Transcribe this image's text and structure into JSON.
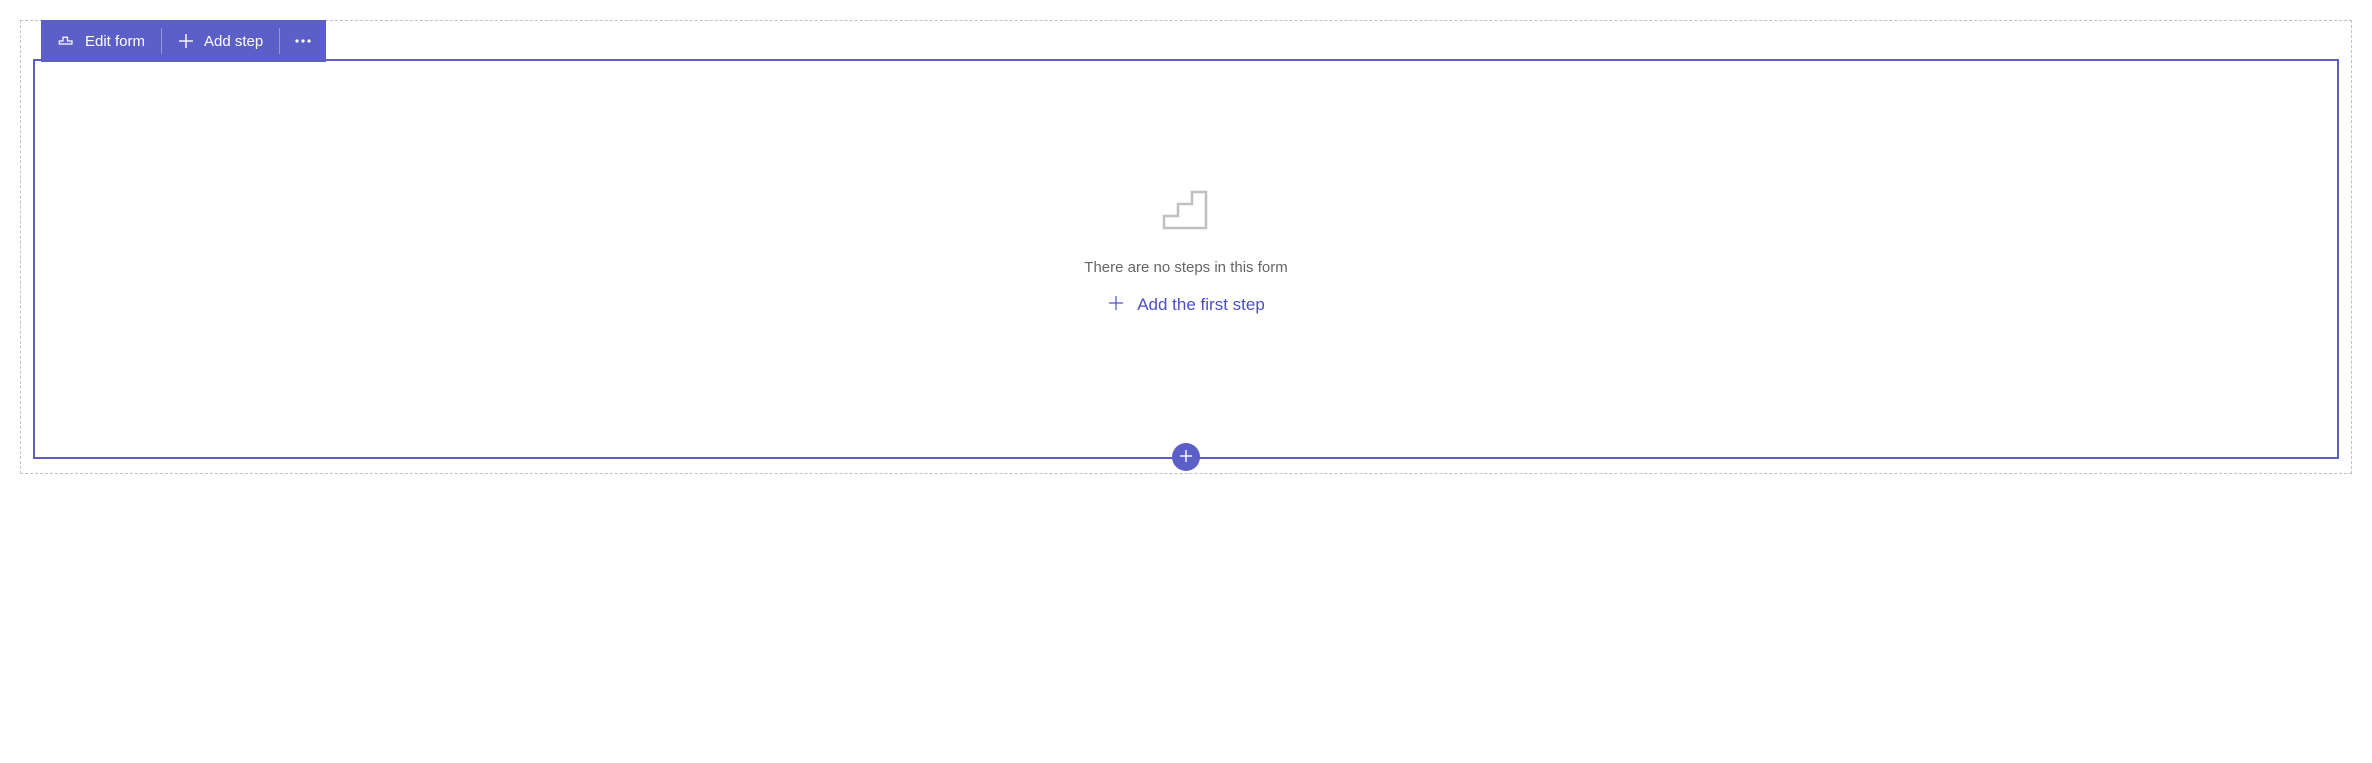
{
  "toolbar": {
    "edit_form_label": "Edit form",
    "add_step_label": "Add step"
  },
  "empty_state": {
    "message": "There are no steps in this form",
    "action_label": "Add the first step"
  },
  "colors": {
    "primary": "#5b5fc7",
    "border_dash": "#c0c0c0",
    "text_muted": "#666666"
  }
}
